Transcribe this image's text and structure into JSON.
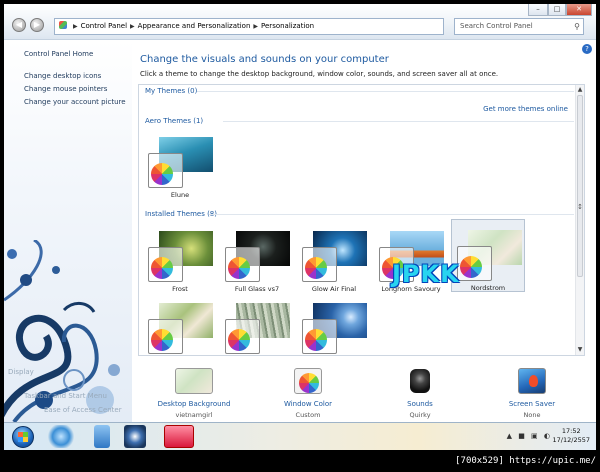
{
  "window": {
    "address": {
      "segments": [
        "Control Panel",
        "Appearance and Personalization",
        "Personalization"
      ]
    },
    "search_placeholder": "Search Control Panel",
    "controls": [
      "–",
      "□",
      "✕"
    ]
  },
  "left_pane": {
    "home_link": "Control Panel Home",
    "links": [
      "Change desktop icons",
      "Change mouse pointers",
      "Change your account picture"
    ],
    "obscured_links": [
      "Display",
      "Taskbar and Start Menu",
      "Ease of Access Center"
    ]
  },
  "main": {
    "heading": "Change the visuals and sounds on your computer",
    "subheading": "Click a theme to change the desktop background, window color, sounds, and screen saver all at once.",
    "help_icon": "?",
    "sections": {
      "my_themes": "My Themes (0)",
      "get_more": "Get more themes online",
      "aero_themes": "Aero Themes (1)",
      "installed_themes": "Installed Themes (8)"
    },
    "aero": [
      {
        "name": "Elune",
        "thumb": "#2a8fb3"
      }
    ],
    "installed": [
      {
        "name": "Frost",
        "thumb": "#6b8f3a"
      },
      {
        "name": "Full Glass vs7",
        "thumb": "#1b1f1d"
      },
      {
        "name": "Glow Air Final",
        "thumb": "#1e73b6"
      },
      {
        "name": "Longhorn Savoury",
        "thumb": "#6cb0de"
      },
      {
        "name": "Nordstrom",
        "thumb": "#cfe3c3",
        "selected": true
      },
      {
        "name": "",
        "thumb": "#a9c27d"
      },
      {
        "name": "",
        "thumb": "#a8b7a0"
      },
      {
        "name": "",
        "thumb": "#2a63a8"
      }
    ]
  },
  "overlay": {
    "logo_text": "JPKK"
  },
  "bottom": [
    {
      "label": "Desktop Background",
      "value": "vietnamgirl",
      "icon": "desktop-background-icon"
    },
    {
      "label": "Window Color",
      "value": "Custom",
      "icon": "window-color-icon"
    },
    {
      "label": "Sounds",
      "value": "Quirky",
      "icon": "sounds-icon"
    },
    {
      "label": "Screen Saver",
      "value": "None",
      "icon": "screen-saver-icon"
    }
  ],
  "taskbar": {
    "time": "17:52",
    "date": "17/12/2557",
    "tray": "▲ ■ ▣ ◐"
  },
  "watermark": "[700x529] https://upic.me/"
}
